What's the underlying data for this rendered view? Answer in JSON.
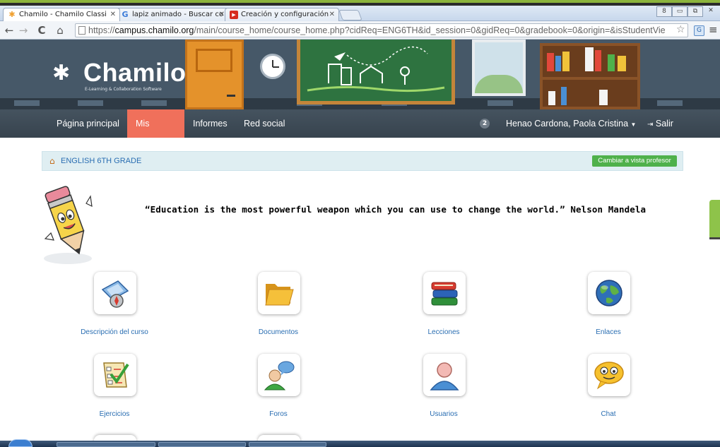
{
  "browser": {
    "tabs": [
      {
        "label": "Chamilo - Chamilo Classi",
        "icon": "chamilo-icon"
      },
      {
        "label": "lapiz animado - Buscar co",
        "icon": "google-icon"
      },
      {
        "label": "Creación y configuración",
        "icon": "youtube-icon"
      }
    ],
    "url_prefix": "https://",
    "url_domain": "campus.chamilo.org",
    "url_rest": "/main/course_home/course_home.php?cidReq=ENG6TH&id_session=0&gidReq=0&gradebook=0&origin=&isStudentVie"
  },
  "header": {
    "logo_name": "Chamilo",
    "logo_tagline": "E-Learning & Collaboration Software"
  },
  "nav": {
    "items": [
      "Página principal",
      "Mis cursos",
      "Informes",
      "Red social"
    ],
    "active_index": 1,
    "badge_count": "2",
    "user_name": "Henao Cardona, Paola Cristina",
    "logout_label": "Salir"
  },
  "course": {
    "title": "ENGLISH 6TH GRADE",
    "switch_view_label": "Cambiar a vista profesor",
    "quote": "“Education is the most powerful weapon which you can use to change the world.”    Nelson Mandela"
  },
  "tools": [
    {
      "label": "Descripción del curso",
      "icon": "compass-icon"
    },
    {
      "label": "Documentos",
      "icon": "folder-icon"
    },
    {
      "label": "Lecciones",
      "icon": "books-icon"
    },
    {
      "label": "Enlaces",
      "icon": "globe-icon"
    },
    {
      "label": "Ejercicios",
      "icon": "checklist-icon"
    },
    {
      "label": "Foros",
      "icon": "forum-icon"
    },
    {
      "label": "Usuarios",
      "icon": "user-icon"
    },
    {
      "label": "Chat",
      "icon": "chat-icon"
    }
  ],
  "colors": {
    "accent_active": "#f0705b",
    "link": "#2a6eb2",
    "button_green": "#4fb14b",
    "navbar": "#3e4b57"
  }
}
